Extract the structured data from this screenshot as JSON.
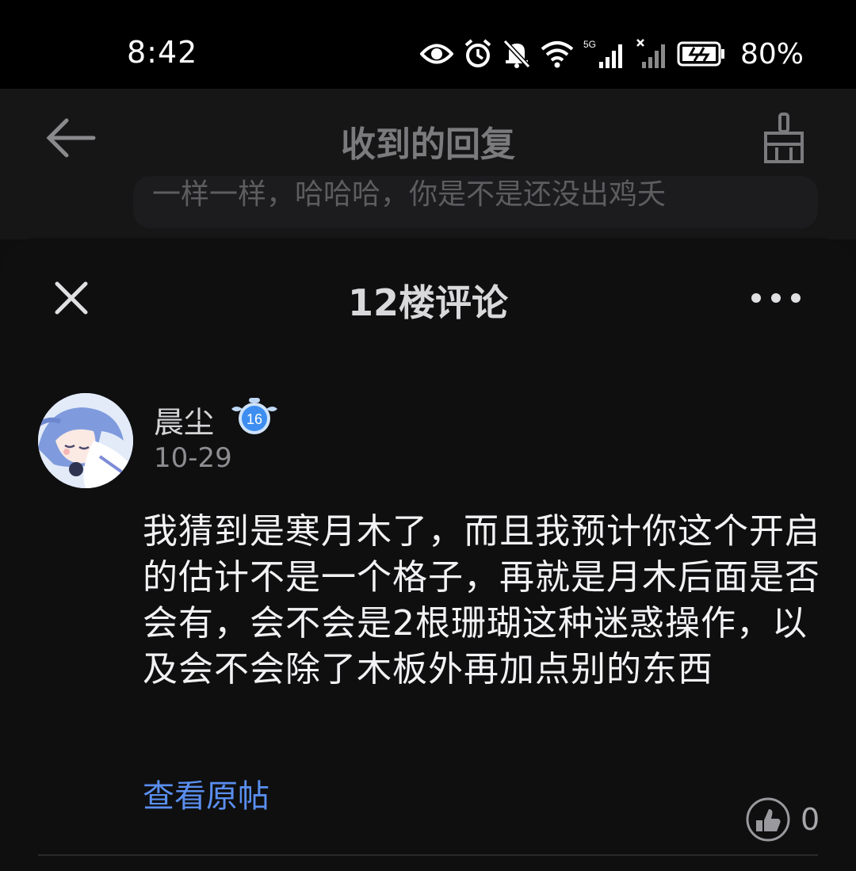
{
  "status_bar": {
    "time": "8:42",
    "battery_percent": "80%",
    "network_label": "5G",
    "icons": [
      "eye-icon",
      "alarm-icon",
      "bell-off-icon",
      "wifi-icon",
      "signal-5g-icon",
      "signal-no-sim-icon",
      "battery-charging-icon"
    ]
  },
  "background_page": {
    "title": "收到的回复",
    "card_snippet": "一样一样，哈哈哈，你是不是还没出鸡夭"
  },
  "sheet": {
    "title": "12楼评论"
  },
  "comment": {
    "username": "晨尘",
    "level": "16",
    "date": "10-29",
    "text": "我猜到是寒月木了，而且我预计你这个开启的估计不是一个格子，再就是月木后面是否会有，会不会是2根珊瑚这种迷惑操作，以及会不会除了木板外再加点别的东西",
    "view_original_label": "查看原帖",
    "like_count": "0"
  },
  "colors": {
    "link": "#5a8ff0",
    "badge": "#3d8ef0",
    "background": "#0f0f10"
  }
}
